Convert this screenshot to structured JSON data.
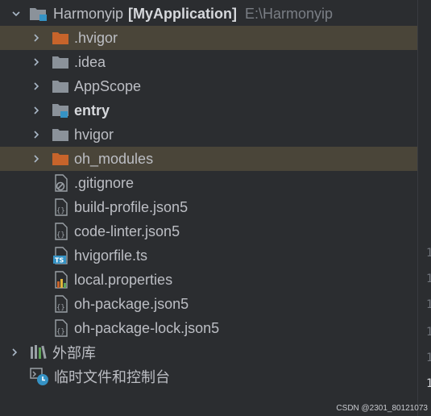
{
  "project": {
    "name": "Harmonyip",
    "module_label": "[MyApplication]",
    "path": "E:\\Harmonyip"
  },
  "tree": {
    "items": [
      {
        "label": ".hvigor"
      },
      {
        "label": ".idea"
      },
      {
        "label": "AppScope"
      },
      {
        "label": "entry"
      },
      {
        "label": "hvigor"
      },
      {
        "label": "oh_modules"
      },
      {
        "label": ".gitignore"
      },
      {
        "label": "build-profile.json5"
      },
      {
        "label": "code-linter.json5"
      },
      {
        "label": "hvigorfile.ts"
      },
      {
        "label": "local.properties"
      },
      {
        "label": "oh-package.json5"
      },
      {
        "label": "oh-package-lock.json5"
      }
    ],
    "external_libs": "外部库",
    "scratches": "临时文件和控制台"
  },
  "gutter": [
    "1",
    "1",
    "1",
    "1",
    "1",
    "1"
  ],
  "watermark": "CSDN @2301_80121073",
  "colors": {
    "background": "#2b2d30",
    "highlight_row": "#4a4539",
    "excluded_folder": "#c7642b",
    "folder": "#8b929a",
    "module_badge": "#3592c4",
    "text": "#bcbec4"
  },
  "icons": {
    "folder": "folder-icon",
    "excluded_folder": "excluded-folder-icon",
    "module": "module-folder-icon",
    "json5": "json5-file-icon",
    "ts": "ts-file-icon",
    "properties": "properties-file-icon",
    "gitignore": "gitignore-file-icon",
    "libraries": "libraries-icon",
    "scratches": "scratches-icon",
    "expand": "chevron-right-icon"
  }
}
